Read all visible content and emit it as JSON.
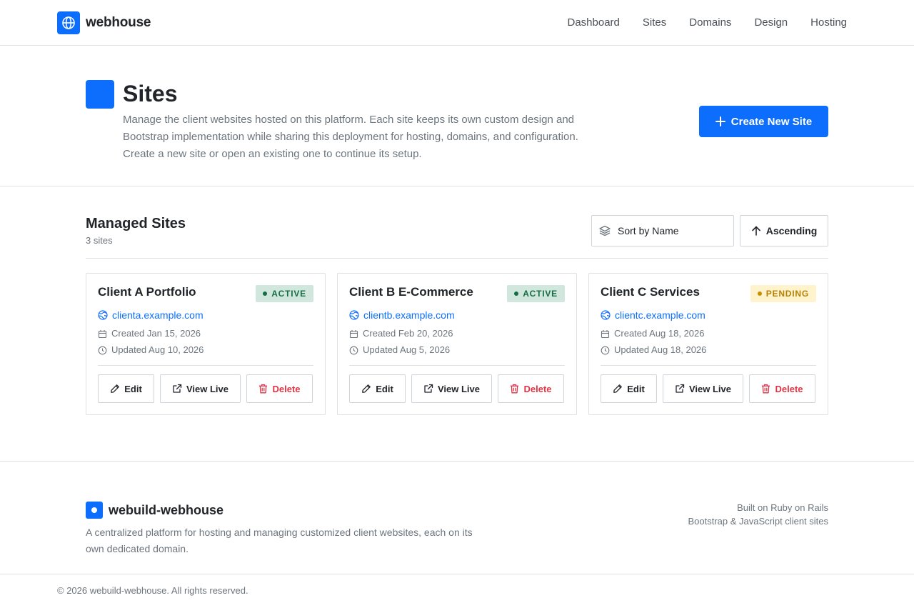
{
  "brand": {
    "name": "webhouse",
    "icon": "globe-icon",
    "color": "#0d6efd"
  },
  "nav": {
    "items": [
      {
        "label": "Dashboard"
      },
      {
        "label": "Sites"
      },
      {
        "label": "Domains"
      },
      {
        "label": "Design"
      },
      {
        "label": "Hosting"
      }
    ]
  },
  "header": {
    "title": "Sites",
    "description": "Manage the client websites hosted on this platform. Each site keeps its own custom design and Bootstrap implementation while sharing this deployment for hosting, domains, and configuration. Create a new site or open an existing one to continue its setup.",
    "create_label": "Create New Site",
    "create_icon": "plus-icon"
  },
  "managed": {
    "title": "Managed Sites",
    "count": "3 sites",
    "sort_label": "Sort by Name",
    "sort_icon": "layers-icon",
    "order_label": "Ascending",
    "order_icon": "arrow-up-icon"
  },
  "card_actions": {
    "edit": "Edit",
    "view": "View Live",
    "delete": "Delete"
  },
  "sites": [
    {
      "name": "Client A Portfolio",
      "status": "ACTIVE",
      "status_color": "#146c43",
      "domain": "clienta.example.com",
      "created": "Created Jan 15, 2026",
      "updated": "Updated Aug 10, 2026"
    },
    {
      "name": "Client B E-Commerce",
      "status": "ACTIVE",
      "status_color": "#146c43",
      "domain": "clientb.example.com",
      "created": "Created Feb 20, 2026",
      "updated": "Updated Aug 5, 2026"
    },
    {
      "name": "Client C Services",
      "status": "PENDING",
      "status_color": "#b58105",
      "domain": "clientc.example.com",
      "created": "Created Aug 18, 2026",
      "updated": "Updated Aug 18, 2026"
    }
  ],
  "footer": {
    "name": "webuild-webhouse",
    "description": "A centralized platform for hosting and managing customized client websites, each on its own dedicated domain.",
    "line1": "Built on Ruby on Rails",
    "line2": "Bootstrap & JavaScript client sites",
    "copyright": "© 2026 webuild-webhouse. All rights reserved."
  },
  "colors": {
    "accent": "#0d6efd",
    "danger": "#dc3545",
    "active_bg": "#d1e7dd",
    "pending_bg": "#fff3cd"
  }
}
